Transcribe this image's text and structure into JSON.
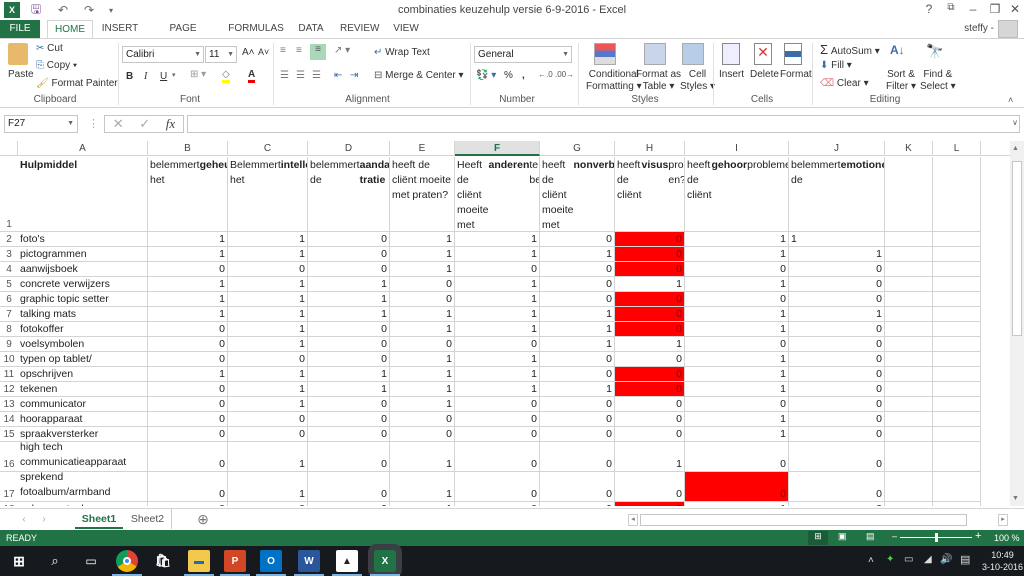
{
  "window": {
    "title": "combinaties keuzehulp versie 6-9-2016 - Excel",
    "user": "steffy -",
    "help_label": "?",
    "controls": [
      "?",
      "restore-ribbon",
      "minimize",
      "restore",
      "close"
    ]
  },
  "quick_access": [
    "save-icon",
    "undo-icon",
    "redo-icon",
    "customize-icon"
  ],
  "tabs": [
    {
      "label": "FILE"
    },
    {
      "label": "HOME",
      "active": true
    },
    {
      "label": "INSERT"
    },
    {
      "label": "PAGE LAYOUT"
    },
    {
      "label": "FORMULAS"
    },
    {
      "label": "DATA"
    },
    {
      "label": "REVIEW"
    },
    {
      "label": "VIEW"
    }
  ],
  "ribbon": {
    "clipboard": {
      "label": "Clipboard",
      "paste": "Paste",
      "cut": "Cut",
      "copy": "Copy",
      "format_painter": "Format Painter"
    },
    "font": {
      "label": "Font",
      "font_name": "Calibri",
      "font_size": "11",
      "bold": "B",
      "italic": "I",
      "underline": "U"
    },
    "alignment": {
      "label": "Alignment",
      "wrap_text": "Wrap Text",
      "merge_center": "Merge & Center"
    },
    "number": {
      "label": "Number",
      "format": "General",
      "percent": "%",
      "comma": ","
    },
    "styles": {
      "label": "Styles",
      "conditional": [
        "Conditional",
        "Formatting"
      ],
      "format_table": [
        "Format as",
        "Table"
      ],
      "cell_styles": [
        "Cell",
        "Styles"
      ]
    },
    "cells": {
      "label": "Cells",
      "insert": "Insert",
      "delete": "Delete",
      "format": "Format"
    },
    "editing": {
      "label": "Editing",
      "autosum": "AutoSum",
      "fill": "Fill",
      "clear": "Clear",
      "sort_filter": [
        "Sort &",
        "Filter"
      ],
      "find_select": [
        "Find &",
        "Select"
      ]
    }
  },
  "formula_bar": {
    "name_box": "F27",
    "formula": "",
    "fx": "fx"
  },
  "sheet": {
    "columns": [
      "A",
      "B",
      "C",
      "D",
      "E",
      "F",
      "G",
      "H",
      "I",
      "J",
      "K",
      "L"
    ],
    "selected_column": "F",
    "header_row": [
      {
        "text": "Hulpmiddel",
        "html": "<b>Hulpmiddel</b>"
      },
      {
        "html": "belemmert het <b>geheugen</b> van de cliënt het gespreK?"
      },
      {
        "html": "Belemmert het <b>intellectueel</b> vermogen van de cliënt het gesprek?"
      },
      {
        "html": "belemmert de <b>aandacht/concen tratie</b> van de cliënt het gesprek?"
      },
      {
        "html": "heeft de cliënt moeite met praten?"
      },
      {
        "html": "Heeft de cliënt moeite met <b>anderen</b> te begrijpen?"
      },
      {
        "html": "heeft de cliënt moeite met <b>nonverbale</b> uitingen te begrijpen?"
      },
      {
        "html": "heeft de cliënt <b>visus</b>problem en?"
      },
      {
        "html": "heeft de cliënt <b>gehoor</b>problemen?"
      },
      {
        "html": "belemmert de <b>emotionele</b> toestand het gesprek?"
      },
      {
        "html": ""
      },
      {
        "html": ""
      }
    ],
    "rows": [
      {
        "n": 2,
        "name": "foto's",
        "vals": [
          1,
          1,
          0,
          1,
          1,
          0,
          0,
          1,
          "1"
        ],
        "red": [
          6
        ],
        "j_left": true
      },
      {
        "n": 3,
        "name": "pictogrammen",
        "vals": [
          1,
          1,
          0,
          1,
          1,
          1,
          0,
          1,
          1
        ],
        "red": [
          6
        ]
      },
      {
        "n": 4,
        "name": "aanwijsboek",
        "vals": [
          0,
          0,
          0,
          1,
          0,
          0,
          0,
          0,
          0
        ],
        "red": [
          6
        ]
      },
      {
        "n": 5,
        "name": "concrete verwijzers",
        "vals": [
          1,
          1,
          1,
          0,
          1,
          0,
          1,
          1,
          0
        ],
        "red": []
      },
      {
        "n": 6,
        "name": "graphic topic setter",
        "vals": [
          1,
          1,
          1,
          0,
          1,
          0,
          0,
          0,
          0
        ],
        "red": [
          6
        ]
      },
      {
        "n": 7,
        "name": "talking mats",
        "vals": [
          1,
          1,
          1,
          1,
          1,
          1,
          0,
          1,
          1
        ],
        "red": [
          6
        ]
      },
      {
        "n": 8,
        "name": "fotokoffer",
        "vals": [
          0,
          1,
          0,
          1,
          1,
          1,
          0,
          1,
          0
        ],
        "red": [
          6
        ]
      },
      {
        "n": 9,
        "name": "voelsymbolen",
        "vals": [
          0,
          1,
          0,
          0,
          0,
          1,
          1,
          0,
          0
        ],
        "red": []
      },
      {
        "n": 10,
        "name": "typen op tablet/",
        "vals": [
          0,
          0,
          0,
          1,
          1,
          0,
          0,
          1,
          0
        ],
        "red": []
      },
      {
        "n": 11,
        "name": "opschrijven",
        "vals": [
          1,
          1,
          1,
          1,
          1,
          0,
          0,
          1,
          0
        ],
        "red": [
          6
        ]
      },
      {
        "n": 12,
        "name": "tekenen",
        "vals": [
          0,
          1,
          1,
          1,
          1,
          1,
          0,
          1,
          0
        ],
        "red": [
          6
        ]
      },
      {
        "n": 13,
        "name": "communicator",
        "vals": [
          0,
          1,
          0,
          1,
          0,
          0,
          0,
          0,
          0
        ],
        "red": []
      },
      {
        "n": 14,
        "name": "hoorapparaat",
        "vals": [
          0,
          0,
          0,
          0,
          0,
          0,
          0,
          1,
          0
        ],
        "red": []
      },
      {
        "n": 15,
        "name": "spraakversterker",
        "vals": [
          0,
          0,
          0,
          0,
          0,
          0,
          0,
          1,
          0
        ],
        "red": []
      },
      {
        "n": 16,
        "name": "high tech communicatieapparaat",
        "vals": [
          0,
          1,
          0,
          1,
          0,
          0,
          1,
          0,
          0
        ],
        "red": [],
        "tall": true
      },
      {
        "n": 17,
        "name": "sprekend fotoalbum/armband",
        "vals": [
          0,
          1,
          0,
          1,
          0,
          0,
          0,
          0,
          0
        ],
        "red": [
          7
        ],
        "tall": true
      },
      {
        "n": 18,
        "name": "geheugentaal",
        "vals": [
          0,
          0,
          0,
          1,
          0,
          0,
          0,
          1,
          0
        ],
        "red": [
          6
        ]
      }
    ]
  },
  "sheet_tabs": [
    {
      "label": "Sheet1",
      "active": true
    },
    {
      "label": "Sheet2"
    }
  ],
  "status": {
    "text": "READY",
    "zoom": "100 %"
  },
  "taskbar": {
    "apps": [
      "start",
      "search",
      "task-view",
      "chrome",
      "store",
      "file-explorer",
      "powerpoint",
      "outlook",
      "word",
      "photos",
      "excel"
    ],
    "time": "10:49",
    "date": "3-10-2016"
  },
  "colors": {
    "accent": "#217346",
    "highlight": "#ff0000"
  }
}
